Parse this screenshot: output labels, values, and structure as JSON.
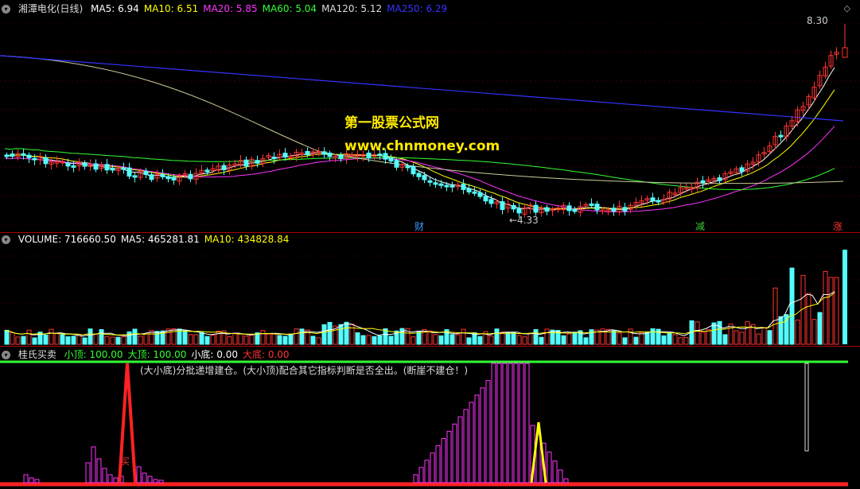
{
  "main": {
    "stock_name": "湘潭电化(日线)",
    "indicators": [
      {
        "label": "MA5: 6.94",
        "color": "#ffffff"
      },
      {
        "label": "MA10: 6.51",
        "color": "#ffff00"
      },
      {
        "label": "MA20: 5.85",
        "color": "#ff33ff"
      },
      {
        "label": "MA60: 5.04",
        "color": "#33ff33"
      },
      {
        "label": "MA120: 5.12",
        "color": "#dddddd"
      },
      {
        "label": "MA250: 6.29",
        "color": "#3333ff"
      }
    ],
    "high_label": "8.30",
    "low_label": "←4.33",
    "markers": [
      {
        "text": "财",
        "color": "#3399ff"
      },
      {
        "text": "减",
        "color": "#33cc33"
      },
      {
        "text": "涨",
        "color": "#ff3333"
      }
    ],
    "watermark_line1": "第一股票公式网",
    "watermark_line2": "www.chnmoney.com"
  },
  "volume": {
    "indicators": [
      {
        "label": "VOLUME: 716660.50",
        "color": "#ffffff"
      },
      {
        "label": "MA5: 465281.81",
        "color": "#ffffff"
      },
      {
        "label": "MA10: 434828.84",
        "color": "#ffff00"
      }
    ]
  },
  "indicator": {
    "name": "桂氏买卖",
    "values": [
      {
        "label": "小顶: 100.00",
        "color": "#33ff33"
      },
      {
        "label": "大顶: 100.00",
        "color": "#33ff33"
      },
      {
        "label": "小底: 0.00",
        "color": "#ffffff"
      },
      {
        "label": "大底: 0.00",
        "color": "#ff3333"
      }
    ],
    "note": "(大小底)分批递增建仓。(大小顶)配合其它指标判断是否全出。(断崖不建仓！)",
    "mark": "买"
  },
  "colors": {
    "up": "#ff3333",
    "down": "#54fcfc",
    "ma250": "#3333ff"
  }
}
